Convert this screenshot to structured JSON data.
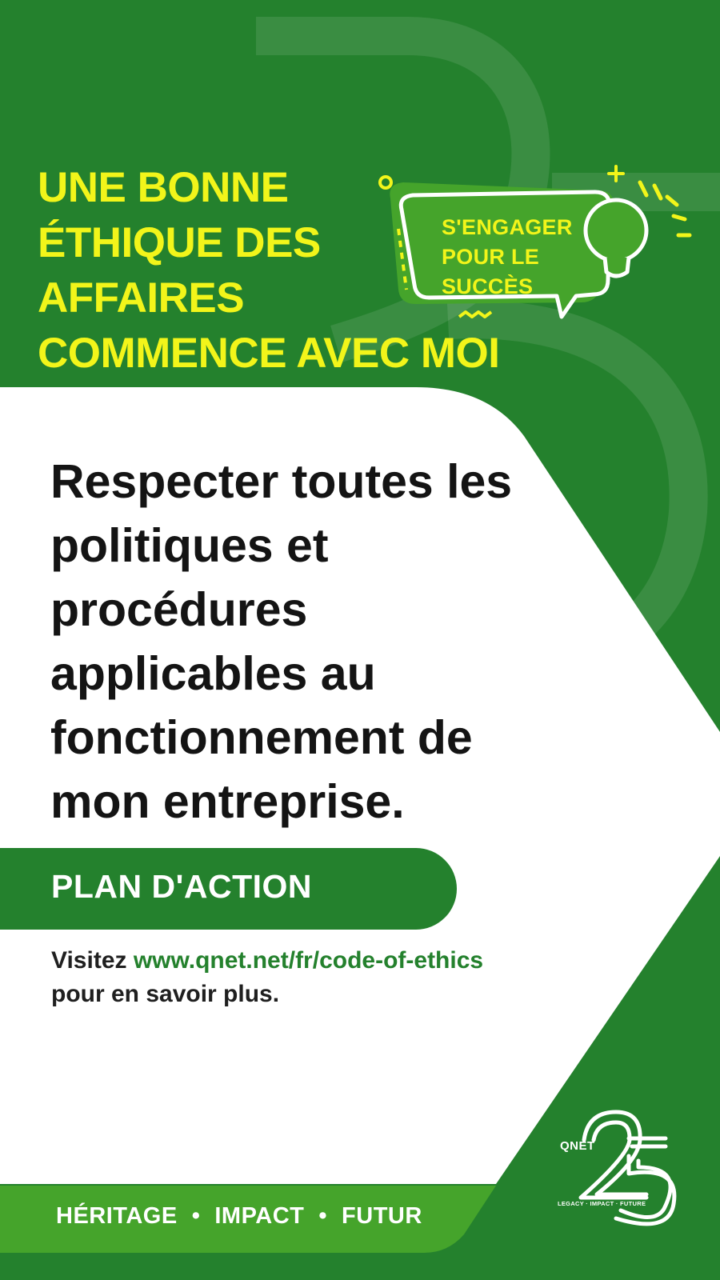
{
  "headline": {
    "lines": [
      "UNE BONNE",
      "ÉTHIQUE DES",
      "AFFAIRES",
      "COMMENCE AVEC MOI"
    ]
  },
  "badge": {
    "lines": [
      "S'ENGAGER",
      "POUR LE",
      "SUCCÈS"
    ]
  },
  "main_statement": {
    "lines": [
      "Respecter toutes les",
      "politiques et",
      "procédures",
      "applicables au",
      "fonctionnement de",
      "mon entreprise."
    ]
  },
  "action_plan": {
    "label": "PLAN D'ACTION"
  },
  "visit": {
    "prefix": "Visitez ",
    "link": "www.qnet.net/fr/code-of-ethics",
    "suffix": "pour en savoir plus."
  },
  "footer": {
    "tags": [
      "HÉRITAGE",
      "IMPACT",
      "FUTUR"
    ],
    "separator": "•"
  },
  "logo": {
    "brand": "QNET",
    "tagline": "LEGACY · IMPACT · FUTURE"
  },
  "colors": {
    "primary_green": "#24812d",
    "light_green": "#45a42b",
    "yellow": "#f2f51a",
    "white": "#ffffff",
    "text_dark": "#141414"
  }
}
